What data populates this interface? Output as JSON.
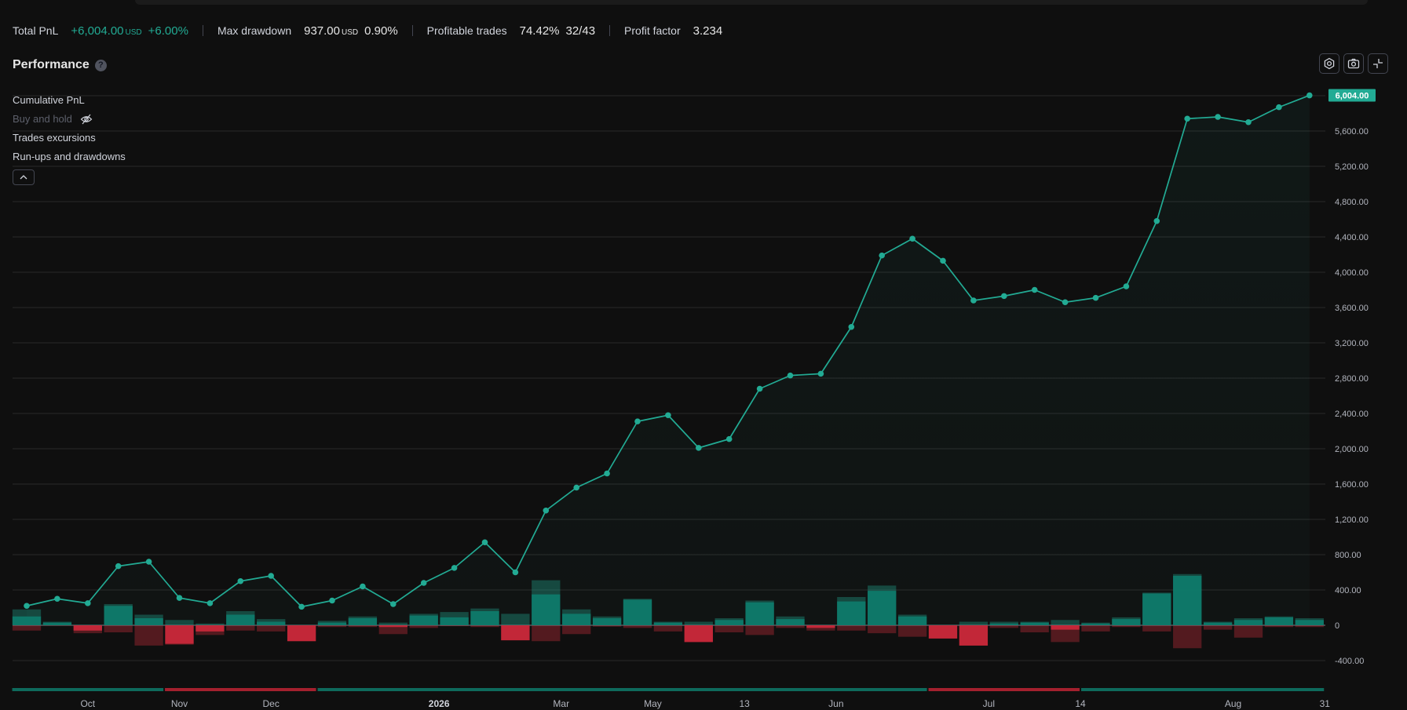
{
  "stats": {
    "total_pnl": {
      "label": "Total PnL",
      "value": "+6,004.00",
      "unit": "USD",
      "percent": "+6.00%"
    },
    "max_drawdown": {
      "label": "Max drawdown",
      "value": "937.00",
      "unit": "USD",
      "percent": "0.90%"
    },
    "profitable_trades": {
      "label": "Profitable trades",
      "percent": "74.42%",
      "ratio": "32/43"
    },
    "profit_factor": {
      "label": "Profit factor",
      "value": "3.234"
    }
  },
  "performance": {
    "title": "Performance",
    "help": "?"
  },
  "legend": {
    "items": [
      {
        "label": "Cumulative PnL",
        "active": true
      },
      {
        "label": "Buy and hold",
        "active": false
      },
      {
        "label": "Trades excursions",
        "active": true
      },
      {
        "label": "Run-ups and drawdowns",
        "active": true
      }
    ]
  },
  "colors": {
    "accent": "#22ab94",
    "negative": "#f23645",
    "grid": "#2a2a2a",
    "background": "#0f0f0f"
  },
  "icons": [
    "help-icon",
    "gear-icon",
    "camera-icon",
    "fullscreen-icon",
    "eye-off-icon",
    "chevron-up-icon"
  ],
  "chart_data": {
    "type": "line",
    "y_ticks": [
      "6,000.00",
      "5,600.00",
      "5,200.00",
      "4,800.00",
      "4,400.00",
      "4,000.00",
      "3,600.00",
      "3,200.00",
      "2,800.00",
      "2,400.00",
      "2,000.00",
      "1,600.00",
      "1,200.00",
      "800.00",
      "400.00",
      "0",
      "-400.00"
    ],
    "ylim": [
      -400,
      6000
    ],
    "last_value_label": "6,004.00",
    "x_labels": [
      {
        "text": "Oct",
        "trade": 2
      },
      {
        "text": "Nov",
        "trade": 5
      },
      {
        "text": "Dec",
        "trade": 8
      },
      {
        "text": "2026",
        "trade": 13.5,
        "bold": true
      },
      {
        "text": "Mar",
        "trade": 17.5
      },
      {
        "text": "May",
        "trade": 20.5
      },
      {
        "text": "13",
        "trade": 23.5
      },
      {
        "text": "Jun",
        "trade": 26.5
      },
      {
        "text": "Jul",
        "trade": 31.5
      },
      {
        "text": "14",
        "trade": 34.5
      },
      {
        "text": "Aug",
        "trade": 39.5
      },
      {
        "text": "31",
        "trade": 42.5
      }
    ],
    "series": [
      {
        "values": [
          220,
          300,
          250,
          670,
          720,
          310,
          250,
          500,
          560,
          210,
          280,
          440,
          240,
          480,
          650,
          940,
          600,
          1300,
          1560,
          1720,
          2310,
          2380,
          2010,
          2110,
          2680,
          2830,
          2850,
          3380,
          4190,
          4380,
          4130,
          3680,
          3730,
          3800,
          3660,
          3710,
          3840,
          4580,
          5740,
          5760,
          5700,
          5870,
          6004
        ]
      }
    ],
    "trade_bars": {
      "runup": [
        180,
        40,
        5,
        240,
        120,
        60,
        20,
        160,
        70,
        5,
        50,
        100,
        30,
        130,
        150,
        190,
        130,
        510,
        180,
        100,
        300,
        40,
        40,
        80,
        280,
        100,
        5,
        320,
        450,
        120,
        5,
        40,
        40,
        40,
        60,
        30,
        90,
        370,
        580,
        40,
        80,
        100,
        80
      ],
      "drawdown": [
        -60,
        -5,
        -90,
        -80,
        -230,
        -220,
        -110,
        -60,
        -70,
        -180,
        -20,
        -20,
        -100,
        -30,
        -10,
        -20,
        -170,
        -180,
        -100,
        -15,
        -30,
        -70,
        -190,
        -80,
        -110,
        -30,
        -60,
        -60,
        -90,
        -130,
        -150,
        -230,
        -30,
        -80,
        -190,
        -70,
        -20,
        -70,
        -260,
        -50,
        -140,
        -20,
        -20
      ],
      "pnl": [
        100,
        30,
        -60,
        220,
        80,
        -210,
        -70,
        120,
        40,
        -180,
        30,
        80,
        -20,
        110,
        90,
        160,
        -170,
        350,
        130,
        80,
        290,
        30,
        -190,
        60,
        260,
        70,
        -30,
        270,
        390,
        100,
        -150,
        -230,
        20,
        30,
        -50,
        20,
        70,
        360,
        560,
        30,
        60,
        90,
        60
      ]
    },
    "period_bands": [
      {
        "from": 0,
        "to": 5,
        "sign": "pos"
      },
      {
        "from": 5,
        "to": 10,
        "sign": "neg"
      },
      {
        "from": 10,
        "to": 30,
        "sign": "pos"
      },
      {
        "from": 30,
        "to": 35,
        "sign": "neg"
      },
      {
        "from": 35,
        "to": 43,
        "sign": "pos"
      }
    ]
  }
}
